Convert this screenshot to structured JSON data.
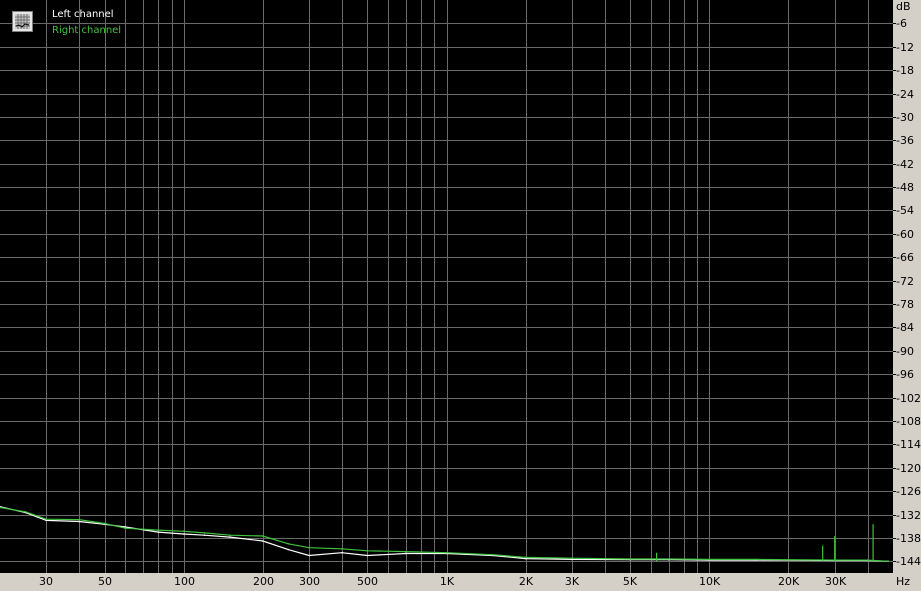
{
  "chart_data": {
    "type": "line",
    "title": "",
    "xlabel": "Hz",
    "ylabel": "dB",
    "xscale": "log",
    "xlim": [
      20,
      50000
    ],
    "ylim": [
      -147,
      0
    ],
    "x_ticks": [
      30,
      50,
      100,
      200,
      300,
      500,
      1000,
      2000,
      3000,
      5000,
      10000,
      20000,
      30000
    ],
    "x_tick_labels": [
      "30",
      "50",
      "100",
      "200",
      "300",
      "500",
      "1K",
      "2K",
      "3K",
      "5K",
      "10K",
      "20K",
      "30K"
    ],
    "y_ticks": [
      -6,
      -12,
      -18,
      -24,
      -30,
      -36,
      -42,
      -48,
      -54,
      -60,
      -66,
      -72,
      -78,
      -84,
      -90,
      -96,
      -102,
      -108,
      -114,
      -120,
      -126,
      -132,
      -138,
      -144
    ],
    "y_tick_labels": [
      "-6",
      "-12",
      "-18",
      "-24",
      "-30",
      "-36",
      "-42",
      "-48",
      "-54",
      "-60",
      "-66",
      "-72",
      "-78",
      "-84",
      "-90",
      "-96",
      "-102",
      "-108",
      "-114",
      "-120",
      "-126",
      "-132",
      "-138",
      "-144"
    ],
    "grid": true,
    "legend_position": "top-left",
    "series": [
      {
        "name": "Left channel",
        "color": "#ffffff",
        "x": [
          20,
          25,
          30,
          40,
          50,
          60,
          80,
          100,
          120,
          150,
          200,
          250,
          300,
          400,
          500,
          700,
          1000,
          1500,
          2000,
          3000,
          5000,
          7000,
          10000,
          15000,
          20000,
          30000,
          40000,
          48000
        ],
        "y": [
          -130,
          -131.5,
          -133.5,
          -133.8,
          -134.5,
          -135.2,
          -136.5,
          -137,
          -137.3,
          -137.8,
          -138.8,
          -141,
          -142.5,
          -141.8,
          -142.5,
          -142,
          -142,
          -142.5,
          -143.3,
          -143.5,
          -143.6,
          -143.6,
          -143.7,
          -143.7,
          -143.7,
          -143.8,
          -143.8,
          -144
        ]
      },
      {
        "name": "Right channel",
        "color": "#3ec43e",
        "x": [
          20,
          25,
          30,
          40,
          50,
          60,
          80,
          100,
          120,
          150,
          200,
          250,
          300,
          400,
          500,
          700,
          1000,
          1500,
          2000,
          3000,
          5000,
          7000,
          10000,
          15000,
          20000,
          30000,
          40000,
          48000
        ],
        "y": [
          -130.2,
          -131.3,
          -133.2,
          -133.3,
          -134.3,
          -135.5,
          -136,
          -136.3,
          -136.7,
          -137.3,
          -137.5,
          -139.5,
          -140.5,
          -140.8,
          -141.3,
          -141.5,
          -141.8,
          -142.3,
          -143,
          -143.2,
          -143.4,
          -143.4,
          -143.5,
          -143.5,
          -143.6,
          -143.7,
          -143.7,
          -144
        ]
      }
    ],
    "annotations": [
      {
        "x": 6300,
        "y": -141.8,
        "series": "Right channel"
      },
      {
        "x": 27000,
        "y": -140,
        "series": "Right channel"
      },
      {
        "x": 30000,
        "y": -137.5,
        "series": "Right channel"
      },
      {
        "x": 42000,
        "y": -134.5,
        "series": "Right channel"
      }
    ]
  },
  "y_unit_label": "dB",
  "x_unit_label": "Hz",
  "legend": {
    "left_label": "Left channel",
    "right_label": "Right channel"
  }
}
